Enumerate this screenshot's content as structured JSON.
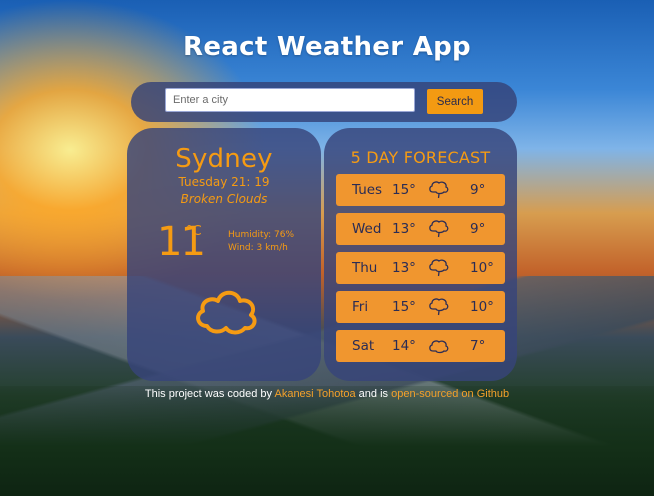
{
  "app": {
    "title": "React Weather App"
  },
  "search": {
    "placeholder": "Enter a city",
    "value": "",
    "button_label": "Search"
  },
  "current": {
    "city": "Sydney",
    "datetime": "Tuesday 21: 19",
    "description": "Broken Clouds",
    "temperature": "11",
    "unit": "°C",
    "humidity": "Humidity: 76%",
    "wind": "Wind: 3 km/h",
    "icon": "cloud-icon"
  },
  "forecast": {
    "title": "5 DAY FORECAST",
    "days": [
      {
        "day": "Tues",
        "high": "15°",
        "low": "9°",
        "icon": "speech-cloud-icon"
      },
      {
        "day": "Wed",
        "high": "13°",
        "low": "9°",
        "icon": "speech-cloud-icon"
      },
      {
        "day": "Thu",
        "high": "13°",
        "low": "10°",
        "icon": "speech-cloud-icon"
      },
      {
        "day": "Fri",
        "high": "15°",
        "low": "10°",
        "icon": "speech-cloud-icon"
      },
      {
        "day": "Sat",
        "high": "14°",
        "low": "7°",
        "icon": "cloud-icon"
      }
    ]
  },
  "footer": {
    "text1": "This project was coded by ",
    "author": "Akanesi Tohotoa",
    "text2": " and is ",
    "repo_link": "open-sourced on Github"
  },
  "colors": {
    "accent": "#f59b13",
    "card": "#37447a",
    "row": "#f0962f"
  }
}
